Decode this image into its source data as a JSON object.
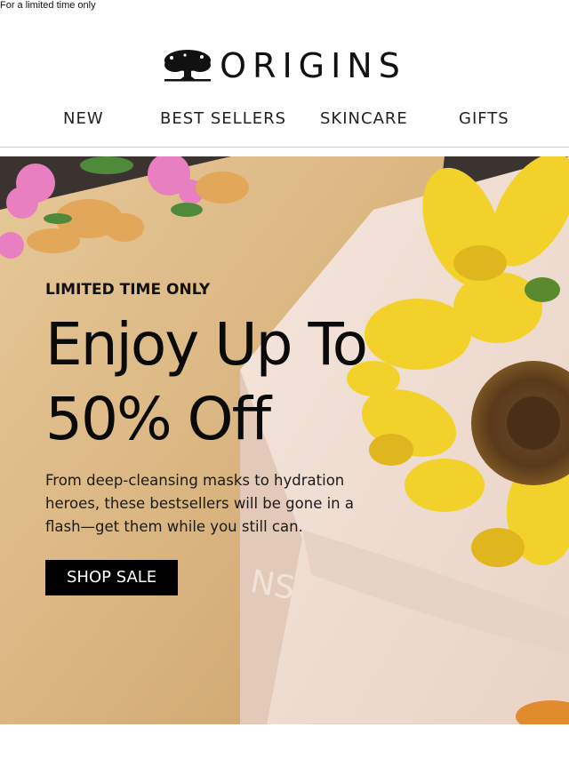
{
  "preheader": {
    "text": "For a limited time only"
  },
  "brand": {
    "name": "ORIGINS"
  },
  "nav": {
    "items": [
      {
        "label": "NEW"
      },
      {
        "label": "BEST SELLERS"
      },
      {
        "label": "SKINCARE"
      },
      {
        "label": "GIFTS"
      }
    ]
  },
  "hero": {
    "eyebrow": "LIMITED TIME ONLY",
    "headline_line1": "Enjoy Up To",
    "headline_line2": "50% Off",
    "body": "From deep-cleansing masks to hydration heroes, these bestsellers will be gone in a flash—get them while you still can.",
    "cta_label": "SHOP SALE",
    "bag_print": "NS"
  },
  "colors": {
    "cta_background": "#000000",
    "kraft_paper": "#d9b784",
    "sunflower": "#f2d22a",
    "carnation": "#e77fc0"
  }
}
